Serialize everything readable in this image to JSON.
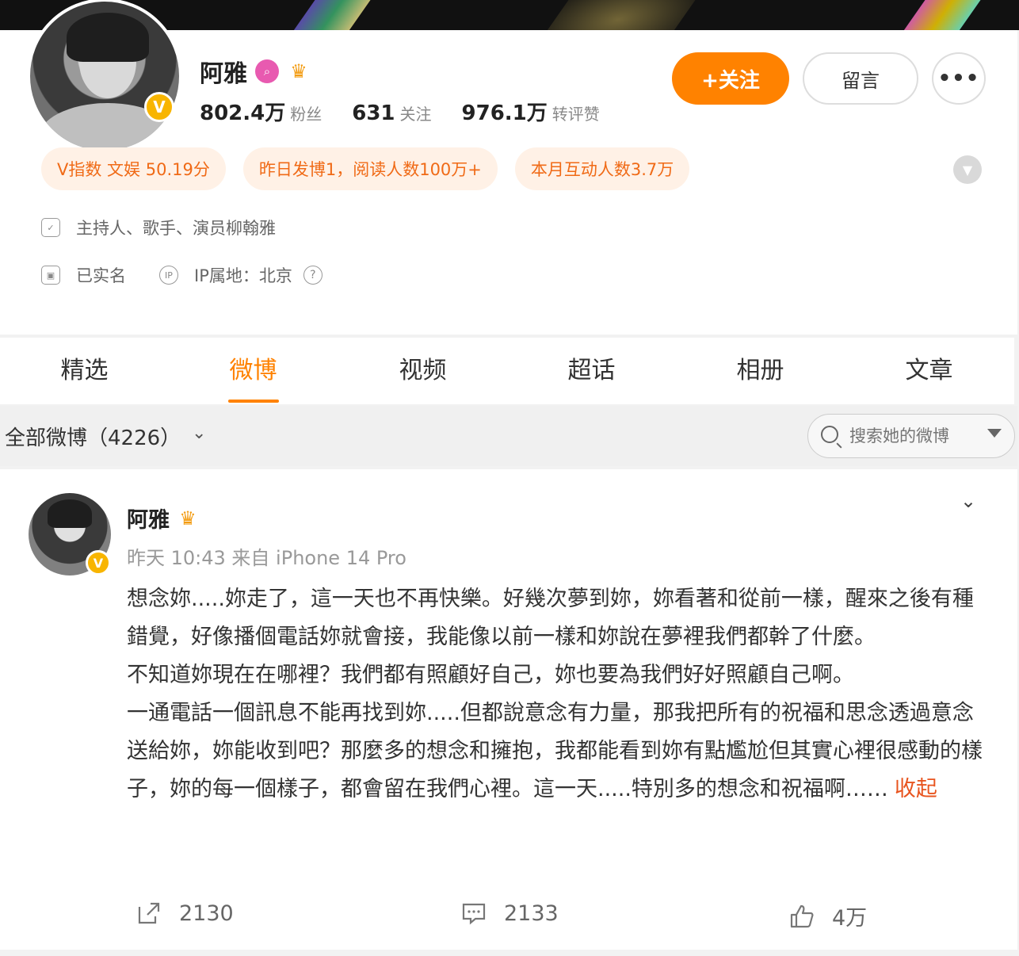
{
  "profile": {
    "name": "阿雅",
    "stats": [
      {
        "value": "802.4万",
        "label": "粉丝"
      },
      {
        "value": "631",
        "label": "关注"
      },
      {
        "value": "976.1万",
        "label": "转评赞"
      }
    ],
    "follow_label": "+关注",
    "message_label": "留言",
    "more_label": "•••",
    "pills": [
      "V指数 文娱 50.19分",
      "昨日发博1，阅读人数100万+",
      "本月互动人数3.7万"
    ],
    "bio": "主持人、歌手、演员柳翰雅",
    "verified_text": "已实名",
    "ip_text": "IP属地：北京",
    "ip_help": "?"
  },
  "tabs": [
    {
      "label": "精选"
    },
    {
      "label": "微博"
    },
    {
      "label": "视频"
    },
    {
      "label": "超话"
    },
    {
      "label": "相册"
    },
    {
      "label": "文章"
    }
  ],
  "active_tab_index": 1,
  "filter": {
    "label": "全部微博（4226）",
    "search_placeholder": "搜索她的微博"
  },
  "post": {
    "author": "阿雅",
    "meta": "昨天 10:43 来自 iPhone 14 Pro",
    "paragraphs": [
      "想念妳.....妳走了，這一天也不再快樂。好幾次夢到妳，妳看著和從前一樣，醒來之後有種錯覺，好像播個電話妳就會接，我能像以前一樣和妳說在夢裡我們都幹了什麼。",
      "不知道妳現在在哪裡？我們都有照顧好自己，妳也要為我們好好照顧自己啊。",
      "一通電話一個訊息不能再找到妳.....但都說意念有力量，那我把所有的祝福和思念透過意念送給妳，妳能收到吧？那麼多的想念和擁抱，我都能看到妳有點尷尬但其實心裡很感動的樣子，妳的每一個樣子，都會留在我們心裡。這一天.....特別多的想念和祝福啊……"
    ],
    "collapse_label": "收起",
    "actions": {
      "repost": "2130",
      "comment": "2133",
      "like": "4万"
    }
  },
  "colors": {
    "accent": "#ff8200",
    "pill_bg": "#fff1e6",
    "pill_text": "#f06a16",
    "link_red": "#e8541e"
  }
}
